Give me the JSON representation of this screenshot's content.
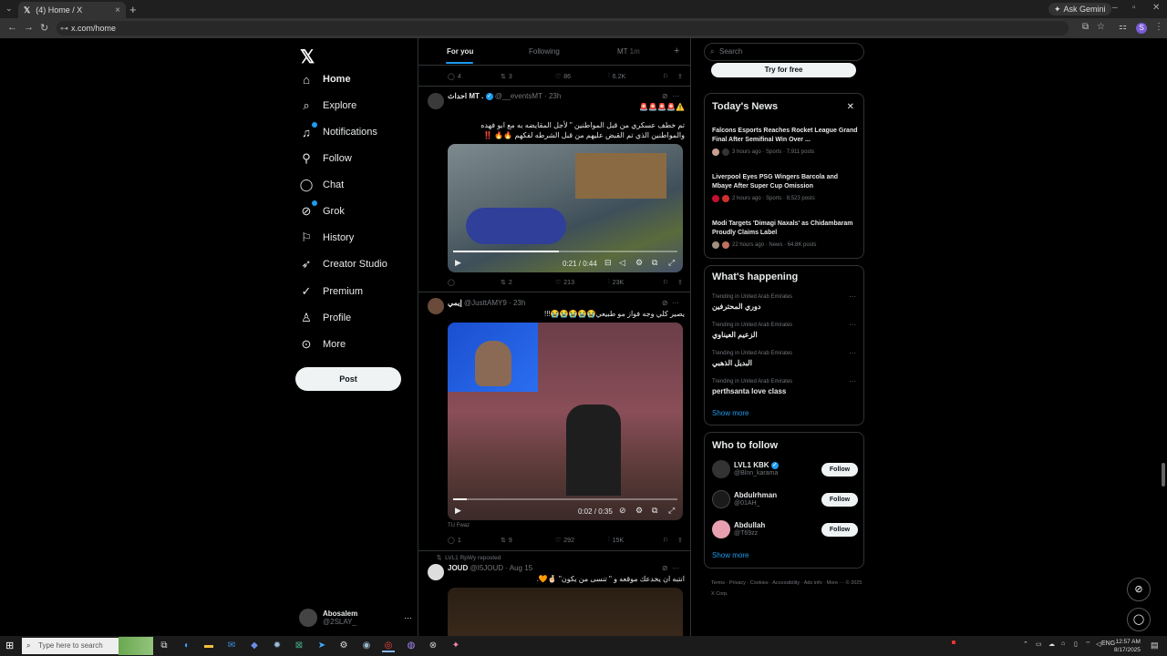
{
  "browser": {
    "tab_title": "(4) Home / X",
    "url": "x.com/home",
    "ask_gemini": "Ask Gemini",
    "profile_initial": "S"
  },
  "sidebar": {
    "items": [
      {
        "label": "Home",
        "icon": "home-icon"
      },
      {
        "label": "Explore",
        "icon": "search-icon"
      },
      {
        "label": "Notifications",
        "icon": "bell-icon"
      },
      {
        "label": "Follow",
        "icon": "person-add-icon"
      },
      {
        "label": "Chat",
        "icon": "chat-icon"
      },
      {
        "label": "Grok",
        "icon": "grok-icon"
      },
      {
        "label": "History",
        "icon": "bookmark-icon"
      },
      {
        "label": "Creator Studio",
        "icon": "rocket-icon"
      },
      {
        "label": "Premium",
        "icon": "verified-icon"
      },
      {
        "label": "Profile",
        "icon": "person-icon"
      },
      {
        "label": "More",
        "icon": "more-circle-icon"
      }
    ],
    "post_label": "Post",
    "account": {
      "name": "Abosalem",
      "handle": "@2SLAY_"
    }
  },
  "feed": {
    "tabs": [
      "For you",
      "Following",
      "MT"
    ],
    "tab_mt_badge": "1m",
    "top_actions": {
      "replies": "4",
      "reposts": "3",
      "likes": "86",
      "views": "6.2K"
    },
    "tweets": [
      {
        "name": "احداث MT .",
        "handle": "@__eventsMT",
        "time": "23h",
        "emoji_line": "⚠️🚨🚨🚨🚨",
        "text": "تم خطف عسكري من قبل المواطنين \" لأجل المقايضه به مع ابو فهده والمواطنين الذي تم القبض عليهم من قبل الشرطه لفكهم 🔥🔥 ‼️",
        "video_time": "0:21 / 0:44",
        "progress": 0.47,
        "actions": {
          "replies": "",
          "reposts": "2",
          "likes": "213",
          "views": "23K"
        }
      },
      {
        "name": "إيمي",
        "handle": "@JusttAMY9",
        "time": "23h",
        "text": "يصير كلي وجه فواز مو طبيعي😭😭😭😭😭!!!",
        "video_time": "0:02 / 0:35",
        "progress": 0.06,
        "caption": "TU Fwaz",
        "actions": {
          "replies": "1",
          "reposts": "9",
          "likes": "292",
          "views": "15K"
        }
      },
      {
        "reposted_by": "LVL1 RpWy reposted",
        "name": "JOUD",
        "handle": "@I5JOUD",
        "time": "Aug 15",
        "text": "انتبه ان يخدعك موقعه و \" تنسى من يكون\" 🤞🏻🧡."
      }
    ]
  },
  "right": {
    "search_placeholder": "Search",
    "try_free": "Try for free",
    "news": {
      "title": "Today's News",
      "items": [
        {
          "title": "Falcons Esports Reaches Rocket League Grand Final After Semifinal Win Over ...",
          "meta": "3 hours ago · Sports · 7,911 posts"
        },
        {
          "title": "Liverpool Eyes PSG Wingers Barcola and Mbaye After Super Cup Omission",
          "meta": "2 hours ago · Sports · 8,523 posts"
        },
        {
          "title": "Modi Targets 'Dimagi Naxals' as Chidambaram Proudly Claims Label",
          "meta": "22 hours ago · News · 64.8K posts"
        }
      ]
    },
    "happening": {
      "title": "What's happening",
      "items": [
        {
          "caption": "Trending in United Arab Emirates",
          "name": "دوري المحترفين"
        },
        {
          "caption": "Trending in United Arab Emirates",
          "name": "الزعيم العيناوي"
        },
        {
          "caption": "Trending in United Arab Emirates",
          "name": "البديل الذهبي"
        },
        {
          "caption": "Trending in United Arab Emirates",
          "name": "perthsanta love class"
        }
      ],
      "show_more": "Show more"
    },
    "who_to_follow": {
      "title": "Who to follow",
      "items": [
        {
          "name": "LVL1 KBK",
          "handle": "@Blnn_karama",
          "button": "Follow"
        },
        {
          "name": "Abdulrhman",
          "handle": "@01AH_",
          "button": "Follow"
        },
        {
          "name": "Abdullah",
          "handle": "@T69zz",
          "button": "Follow"
        }
      ],
      "show_more": "Show more"
    },
    "footer": "Terms  ·  Privacy  ·  Cookies  ·  Accessibility  ·  Ads info  ·  More ···  © 2025 X Corp."
  },
  "taskbar": {
    "search_placeholder": "Type here to search",
    "lang": "ENG",
    "time": "12:57 AM",
    "date": "8/17/2025"
  }
}
